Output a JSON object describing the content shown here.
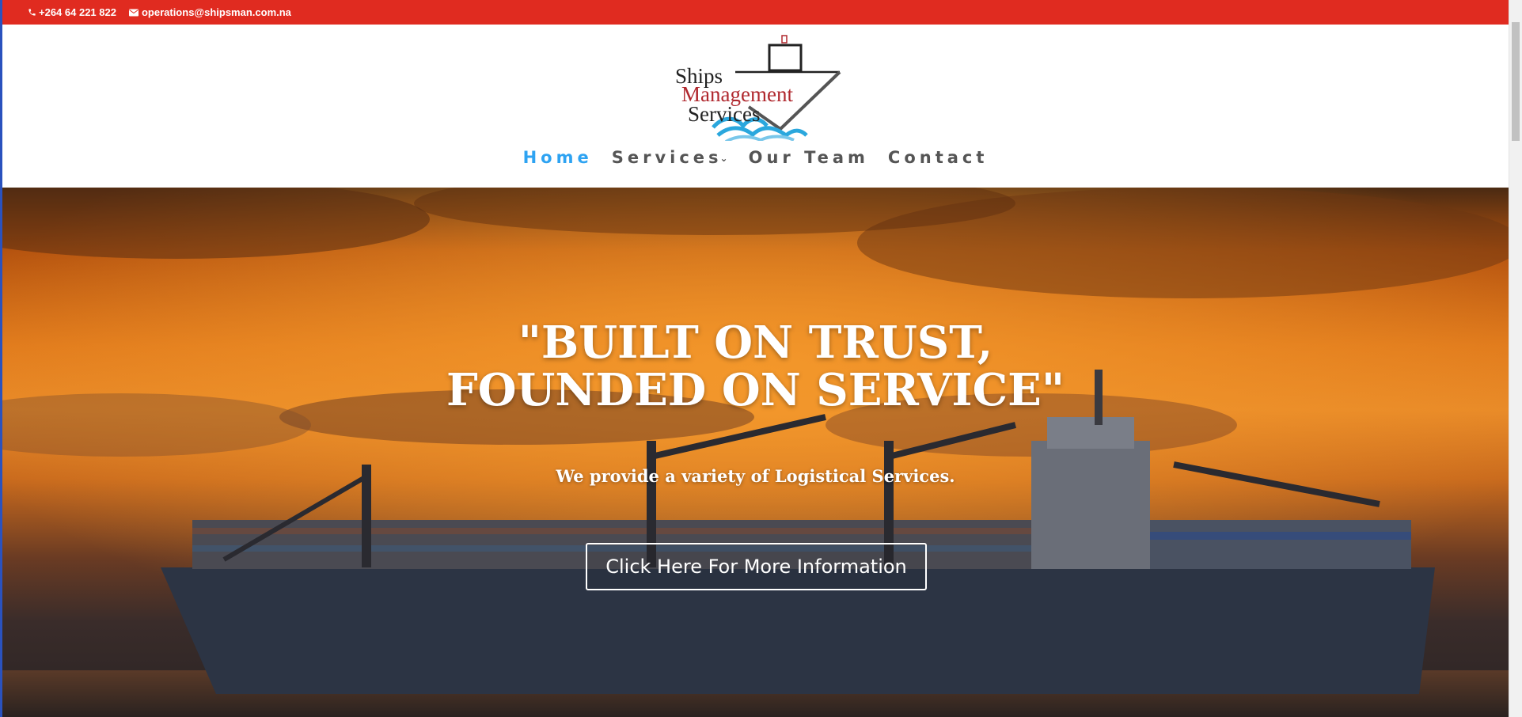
{
  "topbar": {
    "phone": "+264 64 221 822",
    "email": "operations@shipsman.com.na",
    "phone_icon": "phone-icon",
    "email_icon": "envelope-icon",
    "color": "#e02b20"
  },
  "logo": {
    "line1": "Ships",
    "line2": "Management",
    "line3": "Services"
  },
  "nav": {
    "items": [
      {
        "label": "Home",
        "active": true
      },
      {
        "label": "Services",
        "has_dropdown": true
      },
      {
        "label": "Our Team"
      },
      {
        "label": "Contact"
      }
    ],
    "active_color": "#2ea3f2",
    "dropdown_icon": "chevron-down-icon"
  },
  "hero": {
    "title_line1": "\"BUILT ON TRUST,",
    "title_line2": "FOUNDED ON SERVICE\"",
    "subtitle": "We provide a variety of Logistical Services.",
    "button_label": "Click Here For More Information"
  }
}
